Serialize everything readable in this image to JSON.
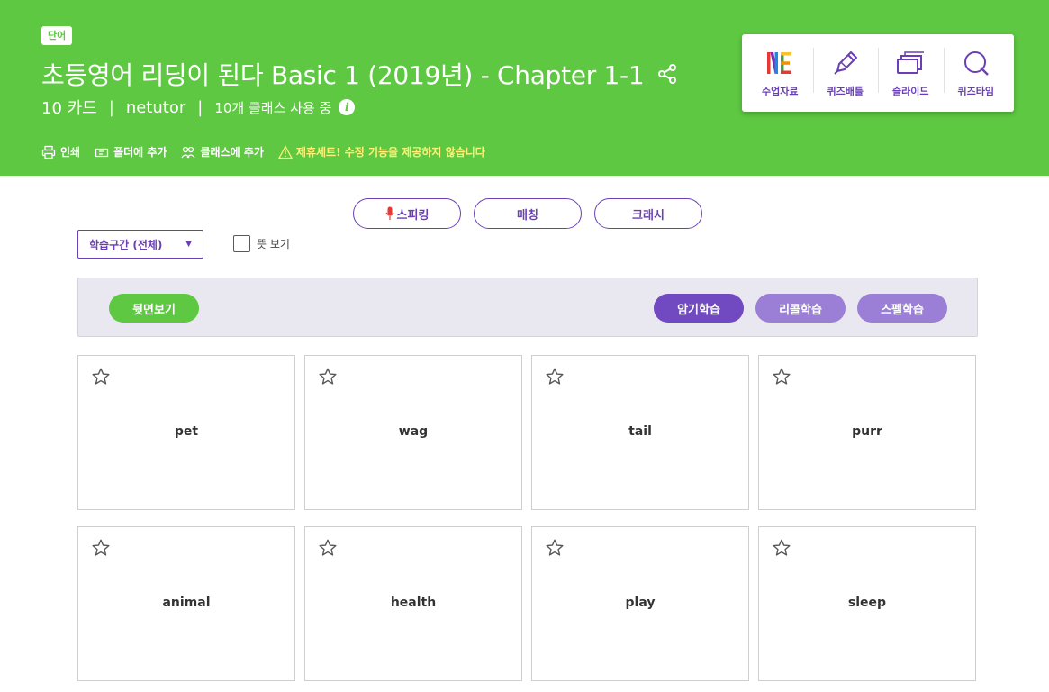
{
  "header": {
    "type_badge": "단어",
    "title": "초등영어 리딩이 된다 Basic 1 (2019년) - Chapter 1-1",
    "card_count": "10 카드",
    "author": "netutor",
    "class_usage": "10개 클래스 사용 중",
    "separator": "|",
    "actions": {
      "print": "인쇄",
      "add_folder": "폴더에 추가",
      "add_class": "클래스에 추가",
      "warning": "제휴세트! 수정 기능을 제공하지 않습니다"
    }
  },
  "tools": {
    "class_material": "수업자료",
    "quiz_battle": "퀴즈배틀",
    "slide": "슬라이드",
    "quiz_time": "퀴즈타임"
  },
  "modes": {
    "speaking": "스피킹",
    "matching": "매칭",
    "crash": "크래시"
  },
  "filters": {
    "range": "학습구간 (전체)",
    "show_meaning": "뜻 보기"
  },
  "study": {
    "flip": "뒷면보기",
    "memorize": "암기학습",
    "recall": "리콜학습",
    "spell": "스펠학습"
  },
  "cards": [
    "pet",
    "wag",
    "tail",
    "purr",
    "animal",
    "health",
    "play",
    "sleep"
  ],
  "colors": {
    "brand_green": "#5ec842",
    "accent_purple": "#6a3fb5",
    "warning_yellow": "#fff176"
  }
}
